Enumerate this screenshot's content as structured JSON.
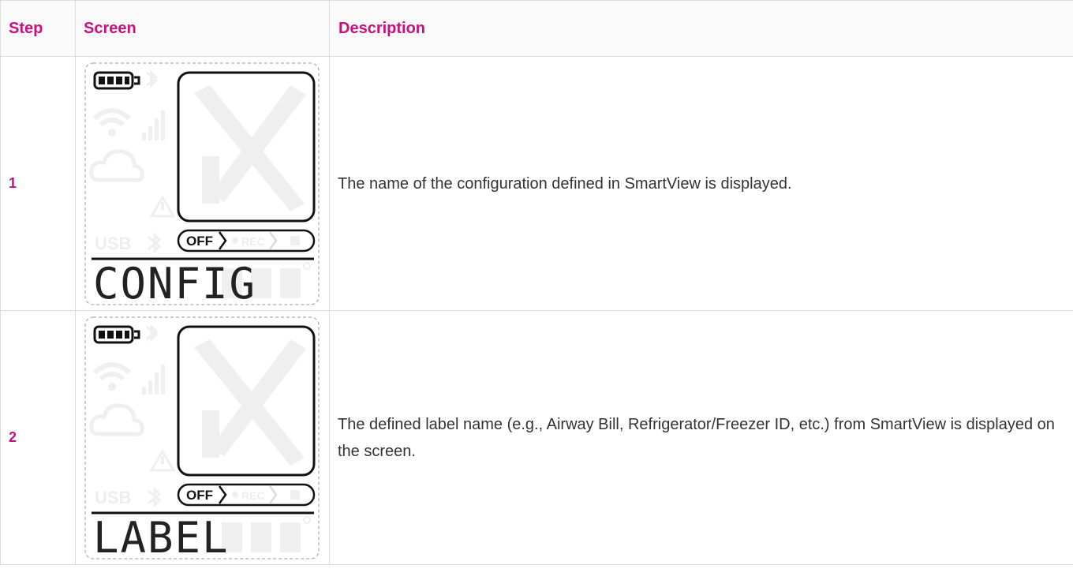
{
  "table": {
    "headers": {
      "step": "Step",
      "screen": "Screen",
      "description": "Description"
    },
    "rows": [
      {
        "step": "1",
        "screen": {
          "display_text": "CONFIG",
          "usb_label": "USB",
          "off_label": "OFF",
          "rec_label": "REC"
        },
        "description": "The name of the configuration defined in SmartView is displayed."
      },
      {
        "step": "2",
        "screen": {
          "display_text": "LABEL",
          "usb_label": "USB",
          "off_label": "OFF",
          "rec_label": "REC"
        },
        "description": "The defined label name (e.g., Airway Bill, Refrigerator/Freezer ID, etc.) from SmartView is displayed on the screen."
      }
    ]
  },
  "colors": {
    "accent": "#c8107e",
    "body_text": "#333333",
    "border": "#dcdcdc",
    "lcd_inactive": "#efefef"
  },
  "icons": [
    "battery-icon",
    "bluetooth-icon",
    "wifi-icon",
    "signal-bars-icon",
    "cloud-icon",
    "warning-icon",
    "record-dot-icon",
    "stop-square-icon"
  ]
}
